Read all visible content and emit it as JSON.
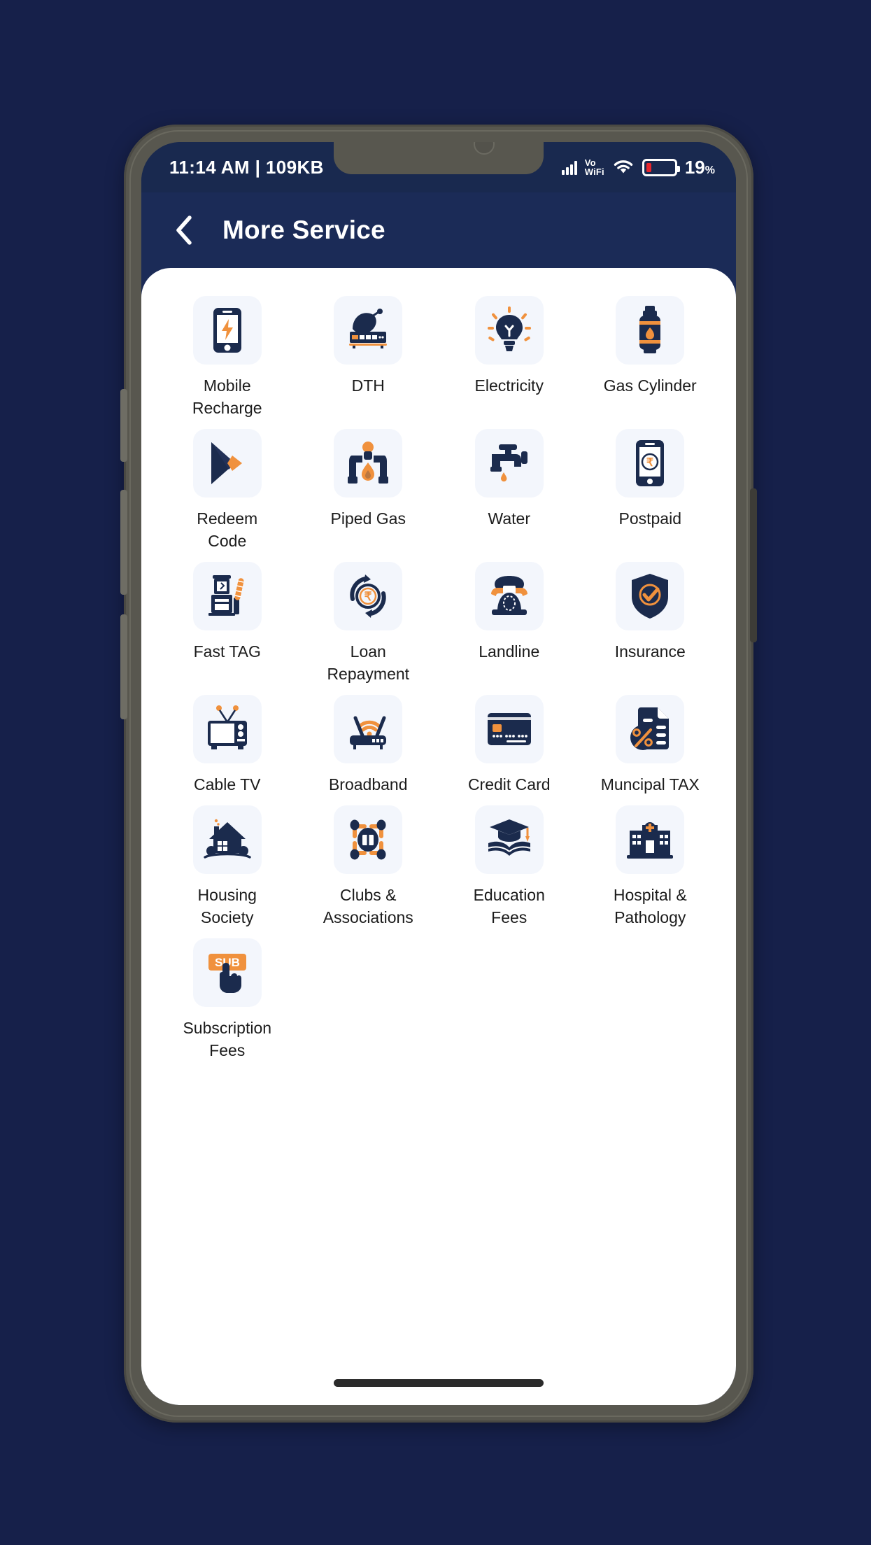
{
  "status_bar": {
    "left_text": "11:14 AM | 109KB",
    "network_label_top": "Vo",
    "network_label_bottom": "WiFi",
    "battery_percent": "19",
    "battery_percent_symbol": "%",
    "battery_level_value": 19,
    "signal_icon": "signal-bars-icon",
    "wifi_icon": "wifi-icon",
    "battery_icon": "battery-icon"
  },
  "header": {
    "back_icon": "chevron-left-icon",
    "title": "More Service"
  },
  "colors": {
    "page_background": "#16204a",
    "phone_frame": "#58574f",
    "app_navy": "#1b2b57",
    "status_navy": "#19294f",
    "sheet_white": "#ffffff",
    "tile_background": "#f3f6fc",
    "icon_navy": "#1b2b4d",
    "icon_orange": "#f0913d",
    "battery_red": "#e8262d",
    "label_text": "#1c1c1c",
    "home_indicator": "#2b2b2b"
  },
  "services": [
    {
      "label": "Mobile Recharge",
      "icon": "mobile-recharge-icon"
    },
    {
      "label": "DTH",
      "icon": "satellite-dish-icon"
    },
    {
      "label": "Electricity",
      "icon": "light-bulb-icon"
    },
    {
      "label": "Gas Cylinder",
      "icon": "gas-cylinder-icon"
    },
    {
      "label": "Redeem Code",
      "icon": "play-store-icon"
    },
    {
      "label": "Piped Gas",
      "icon": "piped-gas-icon"
    },
    {
      "label": "Water",
      "icon": "water-tap-icon"
    },
    {
      "label": "Postpaid",
      "icon": "postpaid-phone-rupee-icon"
    },
    {
      "label": "Fast TAG",
      "icon": "toll-booth-icon"
    },
    {
      "label": "Loan Repayment",
      "icon": "loan-rupee-refresh-icon"
    },
    {
      "label": "Landline",
      "icon": "landline-telephone-icon"
    },
    {
      "label": "Insurance",
      "icon": "shield-check-icon"
    },
    {
      "label": "Cable TV",
      "icon": "television-icon"
    },
    {
      "label": "Broadband",
      "icon": "wifi-router-icon"
    },
    {
      "label": "Credit Card",
      "icon": "credit-card-icon"
    },
    {
      "label": "Muncipal TAX",
      "icon": "tax-document-percent-icon"
    },
    {
      "label": "Housing Society",
      "icon": "house-icon"
    },
    {
      "label": "Clubs & Associations",
      "icon": "clubs-network-icon"
    },
    {
      "label": "Education Fees",
      "icon": "graduation-book-icon"
    },
    {
      "label": "Hospital & Pathology",
      "icon": "hospital-building-icon"
    },
    {
      "label": "Subscription Fees",
      "icon": "subscription-hand-icon"
    }
  ],
  "subscription_badge_text": "SUB"
}
